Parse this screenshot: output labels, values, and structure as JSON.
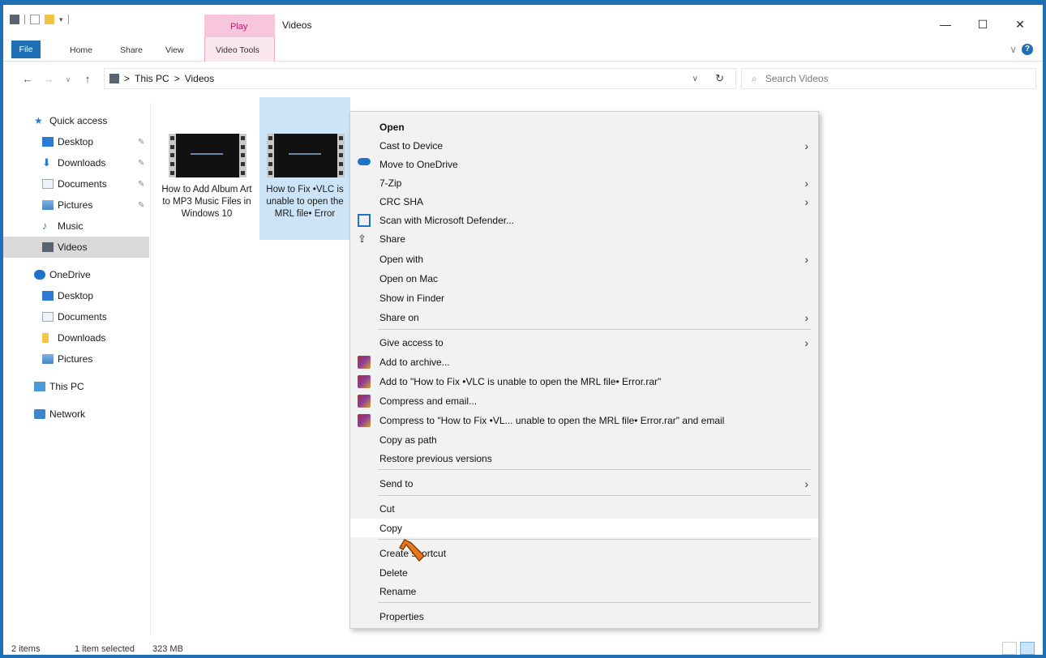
{
  "window": {
    "title": "Videos"
  },
  "colors": {
    "accent": "#1f6fb5",
    "selection": "#cce4f7",
    "menu_bg": "#f2f2f2",
    "context_tab": "#f7c6dd"
  },
  "ribbon": {
    "context_group": "Play",
    "tabs": {
      "file": "File",
      "home": "Home",
      "share": "Share",
      "view": "View",
      "video_tools": "Video Tools"
    }
  },
  "window_controls": {
    "minimize": "—",
    "maximize": "☐",
    "close": "✕"
  },
  "address": {
    "segments": [
      "This PC",
      "Videos"
    ],
    "separator": ">",
    "search_placeholder": "Search Videos"
  },
  "sidebar": {
    "items": [
      {
        "label": "Quick access",
        "icon": "star-icon"
      },
      {
        "label": "Desktop",
        "icon": "desktop-icon",
        "pinned": true
      },
      {
        "label": "Downloads",
        "icon": "download-icon",
        "pinned": true
      },
      {
        "label": "Documents",
        "icon": "documents-icon",
        "pinned": true
      },
      {
        "label": "Pictures",
        "icon": "pictures-icon",
        "pinned": true
      },
      {
        "label": "Music",
        "icon": "music-icon"
      },
      {
        "label": "Videos",
        "icon": "videos-icon",
        "selected": true
      },
      {
        "label": "OneDrive",
        "icon": "cloud-icon"
      },
      {
        "label": "Desktop",
        "icon": "desktop-icon"
      },
      {
        "label": "Documents",
        "icon": "documents-icon"
      },
      {
        "label": "Downloads",
        "icon": "folder-icon"
      },
      {
        "label": "Pictures",
        "icon": "pictures-icon"
      },
      {
        "label": "This PC",
        "icon": "pc-icon"
      },
      {
        "label": "Network",
        "icon": "network-icon"
      }
    ]
  },
  "files": [
    {
      "name": "How to Add Album Art to MP3 Music Files in Windows 10",
      "selected": false
    },
    {
      "name": "How to Fix •VLC is unable to open the MRL file• Error",
      "selected": true
    }
  ],
  "context_menu": {
    "items": [
      {
        "label": "Open",
        "bold": true
      },
      {
        "label": "Cast to Device",
        "submenu": true
      },
      {
        "label": "Move to OneDrive",
        "icon": "onedrive-icon"
      },
      {
        "label": "7-Zip",
        "submenu": true
      },
      {
        "label": "CRC SHA",
        "submenu": true
      },
      {
        "label": "Scan with Microsoft Defender...",
        "icon": "defender-icon"
      },
      {
        "label": "Share",
        "icon": "share-icon"
      },
      {
        "label": "Open with",
        "submenu": true
      },
      {
        "label": "Open on Mac"
      },
      {
        "label": "Show in Finder"
      },
      {
        "label": "Share on",
        "submenu": true
      },
      {
        "label": "Give access to",
        "submenu": true
      },
      {
        "label": "Add to archive...",
        "icon": "winrar-icon"
      },
      {
        "label": "Add to \"How to Fix •VLC is unable to open the MRL file• Error.rar\"",
        "icon": "winrar-icon"
      },
      {
        "label": "Compress and email...",
        "icon": "winrar-icon"
      },
      {
        "label": "Compress to \"How to Fix •VL... unable to open the MRL file• Error.rar\" and email",
        "icon": "winrar-icon"
      },
      {
        "label": "Copy as path"
      },
      {
        "label": "Restore previous versions"
      },
      {
        "label": "Send to",
        "submenu": true
      },
      {
        "label": "Cut"
      },
      {
        "label": "Copy",
        "hovered": true
      },
      {
        "label": "Create shortcut"
      },
      {
        "label": "Delete"
      },
      {
        "label": "Rename"
      },
      {
        "label": "Properties"
      }
    ]
  },
  "status": {
    "item_count": "2 items",
    "selection": "1 item selected",
    "size": "323 MB"
  }
}
